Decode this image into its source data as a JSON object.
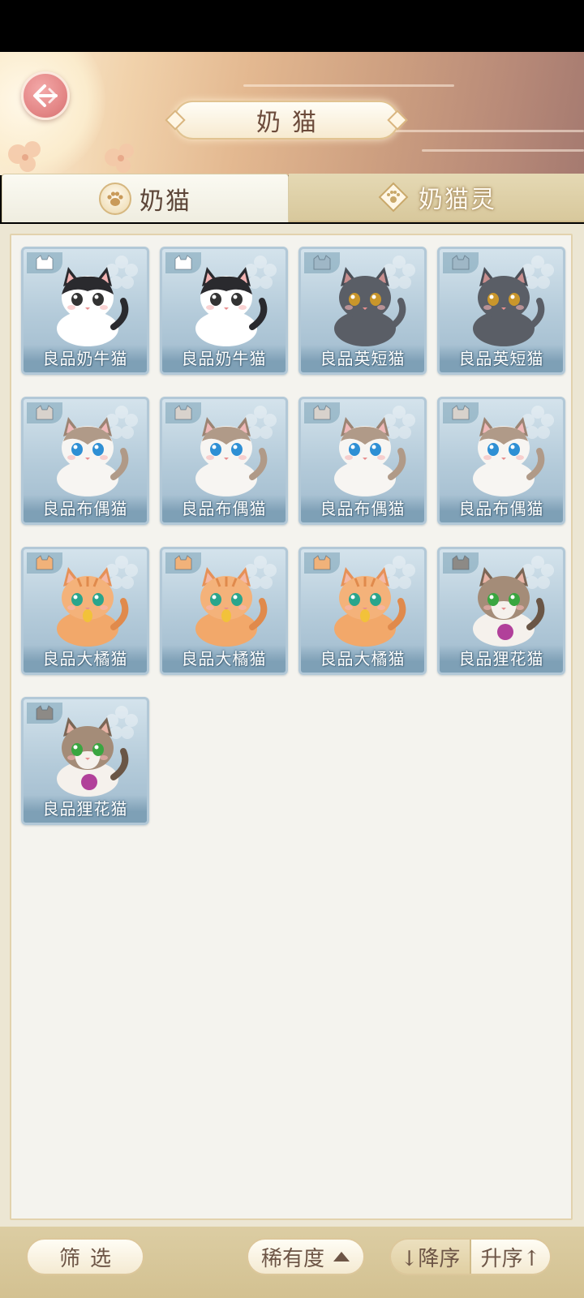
{
  "header": {
    "title": "奶猫",
    "back_icon": "back-arrow-icon"
  },
  "tabs": [
    {
      "label": "奶猫",
      "icon": "paw-icon",
      "active": true
    },
    {
      "label": "奶猫灵",
      "icon": "spirit-icon",
      "active": false
    }
  ],
  "cats": [
    {
      "name": "良品奶牛猫",
      "breed": "cow",
      "badge_color": "#ffffff"
    },
    {
      "name": "良品奶牛猫",
      "breed": "cow",
      "badge_color": "#ffffff"
    },
    {
      "name": "良品英短猫",
      "breed": "shorthair",
      "badge_color": "#9fb7c6"
    },
    {
      "name": "良品英短猫",
      "breed": "shorthair",
      "badge_color": "#9fb7c6"
    },
    {
      "name": "良品布偶猫",
      "breed": "ragdoll",
      "badge_color": "#d8d2cc"
    },
    {
      "name": "良品布偶猫",
      "breed": "ragdoll",
      "badge_color": "#d8d2cc"
    },
    {
      "name": "良品布偶猫",
      "breed": "ragdoll",
      "badge_color": "#d8d2cc"
    },
    {
      "name": "良品布偶猫",
      "breed": "ragdoll",
      "badge_color": "#d8d2cc"
    },
    {
      "name": "良品大橘猫",
      "breed": "orange",
      "badge_color": "#f1b27a"
    },
    {
      "name": "良品大橘猫",
      "breed": "orange",
      "badge_color": "#f1b27a"
    },
    {
      "name": "良品大橘猫",
      "breed": "orange",
      "badge_color": "#f1b27a"
    },
    {
      "name": "良品狸花猫",
      "breed": "tabby",
      "badge_color": "#8d8a86"
    },
    {
      "name": "良品狸花猫",
      "breed": "tabby",
      "badge_color": "#8d8a86"
    }
  ],
  "bottom": {
    "filter_label": "筛选",
    "rarity_label": "稀有度",
    "desc_label": "↓降序",
    "asc_label": "升序↑"
  },
  "colors": {
    "card_bg": "#b3cad9",
    "card_border": "#b2c8d7",
    "accent": "#e48787"
  }
}
